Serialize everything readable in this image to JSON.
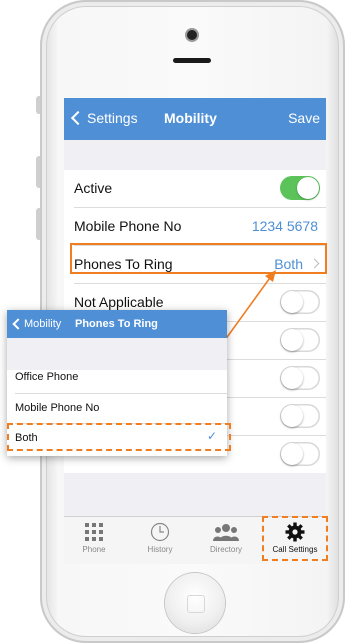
{
  "nav": {
    "back_label": "Settings",
    "title": "Mobility",
    "save_label": "Save"
  },
  "rows": [
    {
      "label": "Active",
      "toggle_on": true
    },
    {
      "label": "Mobile Phone No",
      "value": "1234 5678"
    },
    {
      "label": "Phones To Ring",
      "value": "Both"
    },
    {
      "label": "Not Applicable",
      "toggle_on": false
    }
  ],
  "tabs": [
    {
      "label": "Phone",
      "icon": "keypad-icon"
    },
    {
      "label": "History",
      "icon": "clock-icon"
    },
    {
      "label": "Directory",
      "icon": "people-icon"
    },
    {
      "label": "Call Settings",
      "icon": "gear-icon"
    }
  ],
  "popup": {
    "back_label": "Mobility",
    "title": "Phones To Ring",
    "options": [
      "Office Phone",
      "Mobile Phone No",
      "Both"
    ],
    "selected": "Both",
    "check": "✓"
  },
  "colors": {
    "accent": "#4f8fd6",
    "toggle_on": "#5cc35a",
    "highlight": "#f07d20"
  }
}
